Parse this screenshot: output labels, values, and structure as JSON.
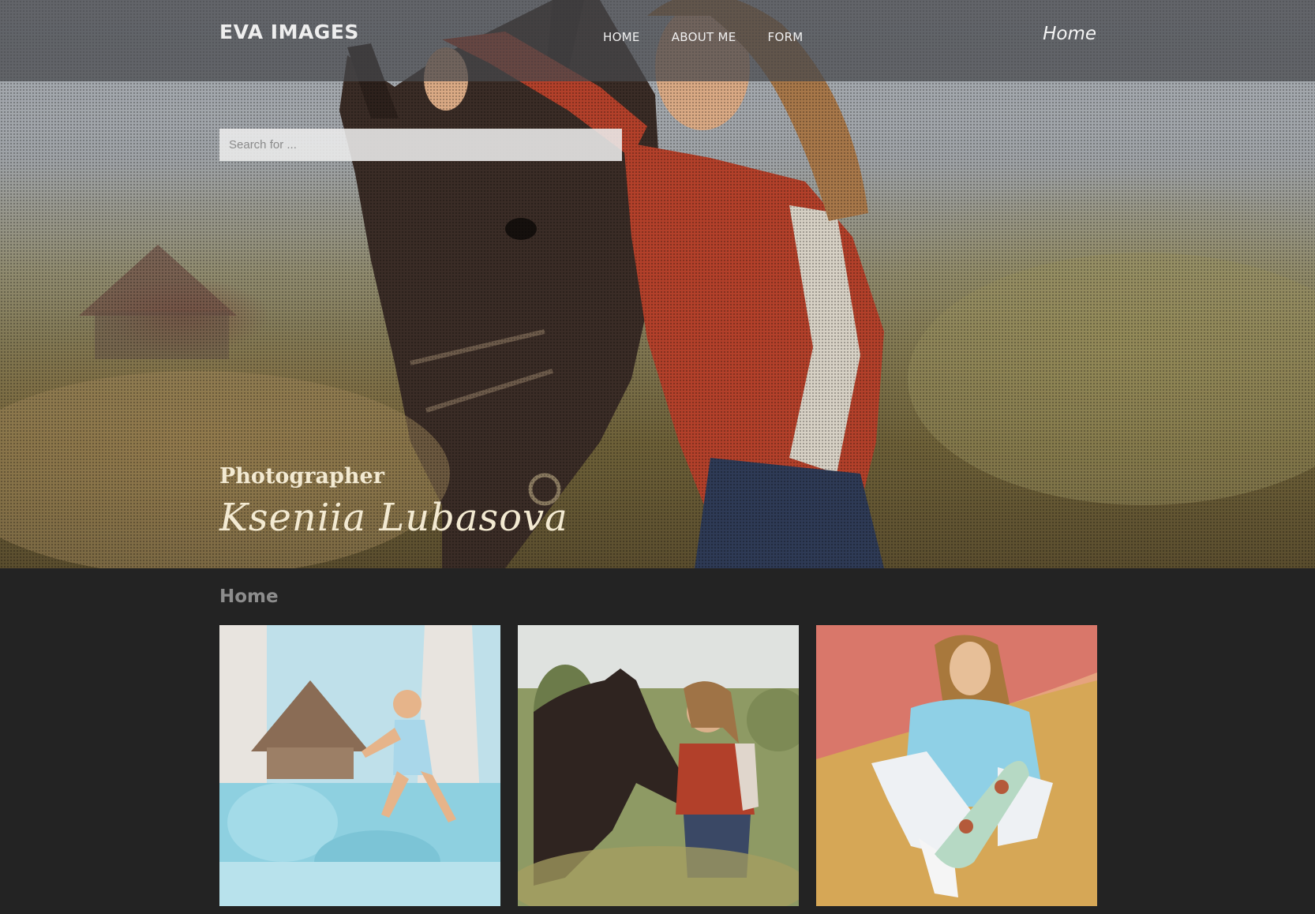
{
  "header": {
    "brand": "EVA IMAGES",
    "nav": [
      {
        "label": "HOME"
      },
      {
        "label": "ABOUT ME"
      },
      {
        "label": "FORM"
      }
    ],
    "current_page": "Home"
  },
  "search": {
    "placeholder": "Search for ..."
  },
  "hero": {
    "subtitle": "Photographer",
    "name": "Kseniia Lubasova"
  },
  "main": {
    "title": "Home",
    "gallery": [
      {
        "subject": "child-on-pillows-photo"
      },
      {
        "subject": "girl-with-horse-photo"
      },
      {
        "subject": "girl-with-skateboard-photo"
      }
    ]
  },
  "colors": {
    "topbar": "#46484c",
    "content_bg": "#232323",
    "section_title": "#8d8d8d",
    "hero_text": "#f3ead2"
  }
}
